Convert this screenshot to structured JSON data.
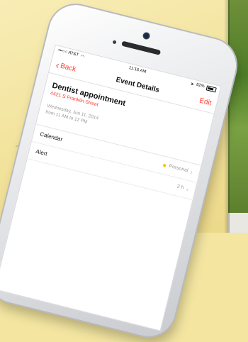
{
  "status_bar": {
    "carrier": "•••○○ AT&T",
    "time": "11:16 AM",
    "battery": "82%"
  },
  "nav": {
    "back_label": "Back",
    "title": "Event Details",
    "edit_label": "Edit"
  },
  "event": {
    "title": "Dentist appointment",
    "location": "4421 S Franklin Street",
    "date_line": "Wednesday, Jun 11, 2014",
    "time_line": "from 11 AM to 12 PM"
  },
  "rows": [
    {
      "label": "Calendar",
      "value": "Personal"
    },
    {
      "label": "Alert",
      "value": "2 h"
    }
  ],
  "colors": {
    "accent_red": "#ff3b30",
    "calendar_dot": "#f2c300"
  }
}
